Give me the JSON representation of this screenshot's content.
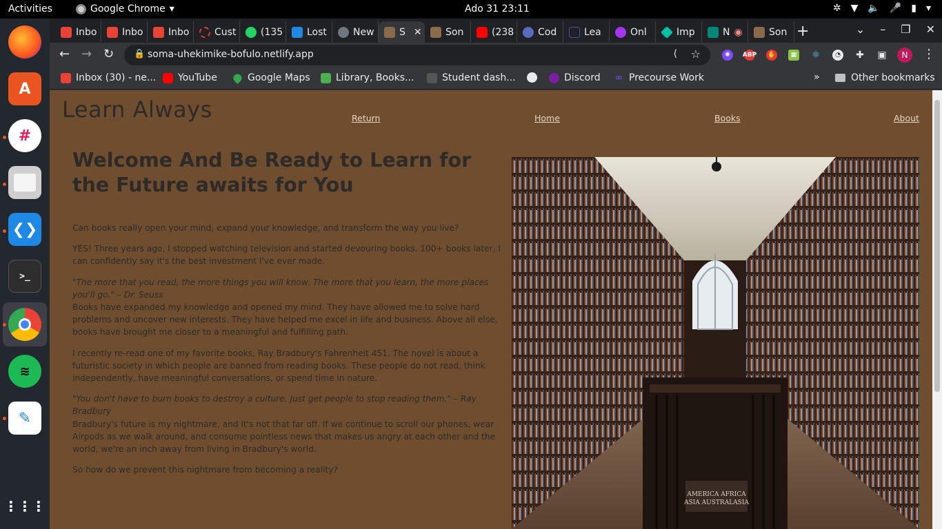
{
  "system": {
    "activities": "Activities",
    "app_name": "Google Chrome",
    "clock": "Ado 31  23:11"
  },
  "tabs": [
    {
      "title": "Inbo",
      "icon": "gmail-icon",
      "color": "#ea4335"
    },
    {
      "title": "Inbo",
      "icon": "gmail-icon",
      "color": "#ea4335"
    },
    {
      "title": "Inbo",
      "icon": "gmail-icon",
      "color": "#ea4335"
    },
    {
      "title": "Cust",
      "icon": "spinner-icon",
      "color": "#e53935"
    },
    {
      "title": "(135",
      "icon": "whatsapp-icon",
      "color": "#25d366"
    },
    {
      "title": "Lost",
      "icon": "page-icon",
      "color": "#1e88e5"
    },
    {
      "title": "New",
      "icon": "github-icon",
      "color": "#6e7681"
    },
    {
      "title": "S",
      "icon": "library-thumb-icon",
      "color": "#8a6a48"
    },
    {
      "title": "Son",
      "icon": "library-thumb-icon",
      "color": "#8a6a48"
    },
    {
      "title": "(238",
      "icon": "youtube-icon",
      "color": "#ff0000"
    },
    {
      "title": "Cod",
      "icon": "code-icon",
      "color": "#5c6bc0"
    },
    {
      "title": "Lea",
      "icon": "doc-icon",
      "color": "#3f51b5"
    },
    {
      "title": "Onl",
      "icon": "udemy-icon",
      "color": "#a435f0"
    },
    {
      "title": "Imp",
      "icon": "diamond-icon",
      "color": "#00bfa5"
    },
    {
      "title": "N",
      "icon": "meet-icon",
      "color": "#00897b"
    },
    {
      "title": "Son",
      "icon": "library-thumb-icon",
      "color": "#8a6a48"
    }
  ],
  "address_bar": {
    "url": "soma-uhekimike-bofulo.netlify.app"
  },
  "profile_initial": "N",
  "bookmarks": [
    {
      "label": "Inbox (30) - ne...",
      "icon": "gmail-icon",
      "color": "#ea4335"
    },
    {
      "label": "YouTube",
      "icon": "youtube-icon",
      "color": "#ff0000"
    },
    {
      "label": "Google Maps",
      "icon": "maps-pin-icon",
      "color": "#34a853"
    },
    {
      "label": "Library, Books...",
      "icon": "px-icon",
      "color": "#4caf50"
    },
    {
      "label": "Student dash...",
      "icon": "alx-icon",
      "color": "#555555"
    },
    {
      "label": "",
      "icon": "globe-icon",
      "color": "#e8eaed"
    },
    {
      "label": "Discord",
      "icon": "discord-icon",
      "color": "#7b1fa2"
    },
    {
      "label": "Precourse Work",
      "icon": "infinity-icon",
      "color": "#7c4dff"
    }
  ],
  "bookmarks_more": "»",
  "other_bookmarks": "Other bookmarks",
  "site": {
    "logo": "Learn Always",
    "nav": [
      "Return",
      "Home",
      "Books",
      "About"
    ],
    "title": "Welcome And Be Ready to Learn for the Future awaits for You",
    "p1": "Can books really open your mind, expand your knowledge, and transform the way you live?",
    "p2": "YES! Three years ago, I stopped watching television and started devouring books. 100+ books later, I can confidently say it's the best investment I've ever made.",
    "quote1": "\"The more that you read, the more things you will know. The more that you learn, the more places you'll go.\" – Dr. Seuss",
    "p3": "Books have expanded my knowledge and opened my mind. They have allowed me to solve hard problems and uncover new interests. They have helped me excel in life and business. Above all else, books have brought me closer to a meaningful and fulfilling path.",
    "p4": "I recently re-read one of my favorite books, Ray Bradbury's Fahrenheit 451. The novel is about a futuristic society in which people are banned from reading books. These people do not read, think independently, have meaningful conversations, or spend time in nature.",
    "quote2": "\"You don't have to burn books to destroy a culture. Just get people to stop reading them.\" – Ray Bradbury",
    "p5": "Bradbury's future is my nightmare, and it's not that far off. If we continue to scroll our phones, wear Airpods as we walk around, and consume pointless news that makes us angry at each other and the world, we're an inch away from living in Bradbury's world.",
    "p6": "So how do we prevent this nightmare from becoming a reality?",
    "image_sign_1": "AMERICA   AFRICA",
    "image_sign_2": "ASIA   AUSTRALASIA"
  },
  "colors": {
    "page_bg": "#6f4e2f",
    "text": "#2e2a28",
    "link": "#e8d6bf"
  }
}
